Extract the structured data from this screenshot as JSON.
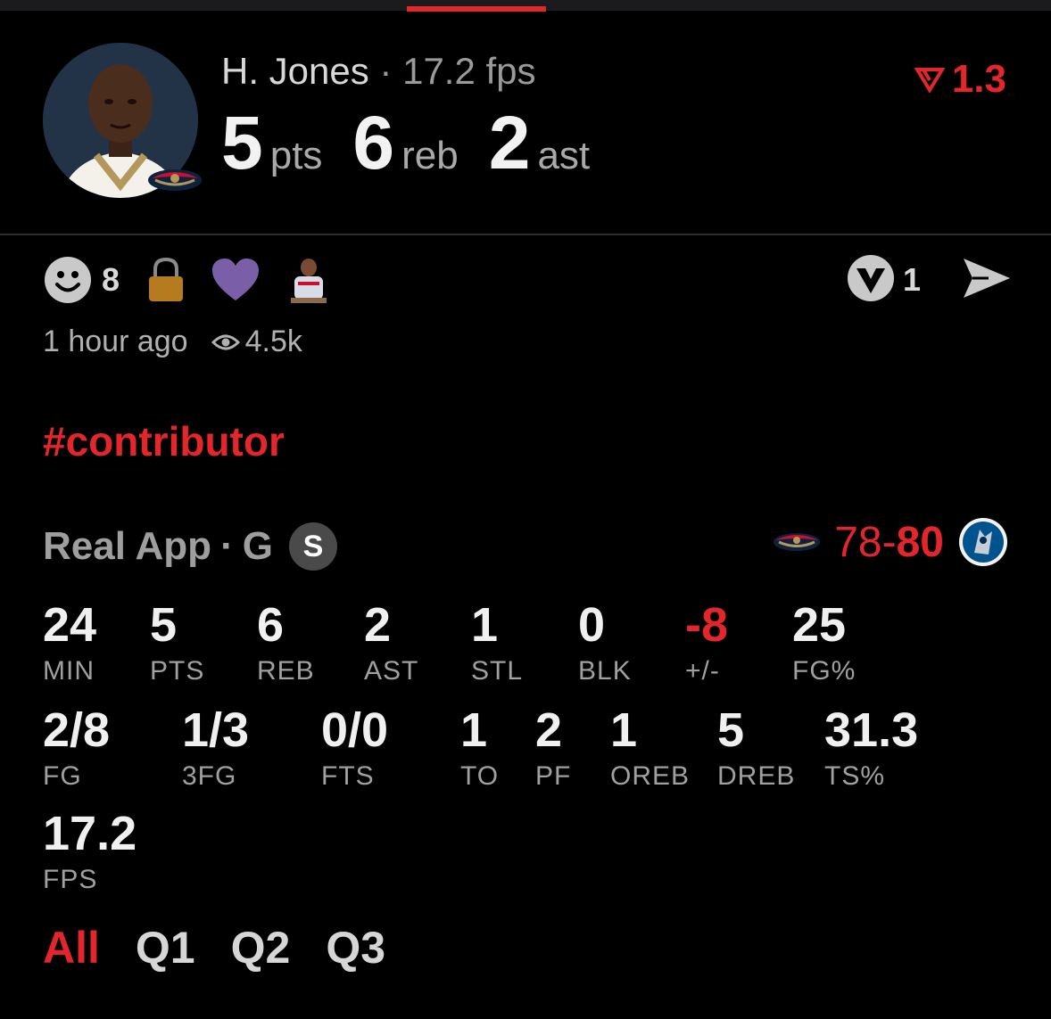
{
  "player": {
    "name": "H. Jones",
    "separator": "·",
    "fps_label": "17.2 fps",
    "headline": [
      {
        "value": "5",
        "unit": "pts"
      },
      {
        "value": "6",
        "unit": "reb"
      },
      {
        "value": "2",
        "unit": "ast"
      }
    ],
    "delta": "1.3"
  },
  "reactions": {
    "smile_count": "8",
    "boost_count": "1"
  },
  "meta": {
    "time_ago": "1 hour ago",
    "views": "4.5k"
  },
  "hashtag": "#contributor",
  "source": {
    "app": "Real App",
    "separator": "·",
    "position": "G",
    "badge": "S"
  },
  "score": {
    "home": "78",
    "dash": "-",
    "away": "80"
  },
  "stats_row1": [
    {
      "value": "24",
      "label": "MIN"
    },
    {
      "value": "5",
      "label": "PTS"
    },
    {
      "value": "6",
      "label": "REB"
    },
    {
      "value": "2",
      "label": "AST"
    },
    {
      "value": "1",
      "label": "STL"
    },
    {
      "value": "0",
      "label": "BLK"
    },
    {
      "value": "-8",
      "label": "+/-"
    },
    {
      "value": "25",
      "label": "FG%"
    }
  ],
  "stats_row2": [
    {
      "value": "2/8",
      "label": "FG"
    },
    {
      "value": "1/3",
      "label": "3FG"
    },
    {
      "value": "0/0",
      "label": "FTS"
    },
    {
      "value": "1",
      "label": "TO"
    },
    {
      "value": "2",
      "label": "PF"
    },
    {
      "value": "1",
      "label": "OREB"
    },
    {
      "value": "5",
      "label": "DREB"
    },
    {
      "value": "31.3",
      "label": "TS%"
    }
  ],
  "stats_row3": [
    {
      "value": "17.2",
      "label": "FPS"
    }
  ],
  "periods": [
    "All",
    "Q1",
    "Q2",
    "Q3"
  ],
  "icons": {
    "accent": "#e2262b",
    "smile": "smile-icon",
    "lock": "lock-icon",
    "heart": "heart-icon",
    "boost": "boost-icon",
    "send": "send-icon",
    "eye": "eye-icon"
  }
}
